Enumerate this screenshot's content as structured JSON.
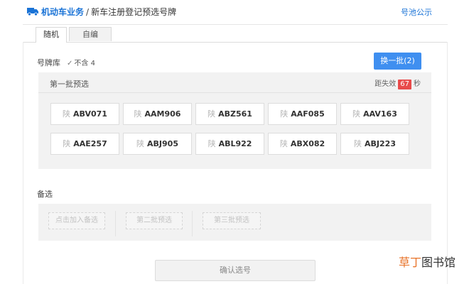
{
  "header": {
    "home_link": "机动车业务",
    "separator": "/",
    "current": "新车注册登记预选号牌",
    "notice_link": "号池公示"
  },
  "tabs": [
    {
      "label": "随机",
      "active": true
    },
    {
      "label": "自编",
      "active": false
    }
  ],
  "library": {
    "label": "号牌库",
    "checkbox_label": "不含 4",
    "checked": true
  },
  "refresh_button": "换一批(2)",
  "batch": {
    "title": "第一批预选",
    "expiry_prefix": "距失效",
    "expiry_count": "67",
    "expiry_unit": "秒"
  },
  "plates": [
    {
      "prefix": "陕",
      "number": "ABV071"
    },
    {
      "prefix": "陕",
      "number": "AAM906"
    },
    {
      "prefix": "陕",
      "number": "ABZ561"
    },
    {
      "prefix": "陕",
      "number": "AAF085"
    },
    {
      "prefix": "陕",
      "number": "AAV163"
    },
    {
      "prefix": "陕",
      "number": "AAE257"
    },
    {
      "prefix": "陕",
      "number": "ABJ905"
    },
    {
      "prefix": "陕",
      "number": "ABL922"
    },
    {
      "prefix": "陕",
      "number": "ABX082"
    },
    {
      "prefix": "陕",
      "number": "ABJ223"
    }
  ],
  "alternates": {
    "label": "备选",
    "slots": [
      "点击加入备选",
      "第二批预选",
      "第三批预选"
    ]
  },
  "confirm_button": "确认选号",
  "watermark": {
    "part1": "草丁",
    "part2": "图书馆"
  },
  "colors": {
    "accent": "#1a73d6",
    "button": "#3f8ff0",
    "countdown": "#e84b4b"
  }
}
